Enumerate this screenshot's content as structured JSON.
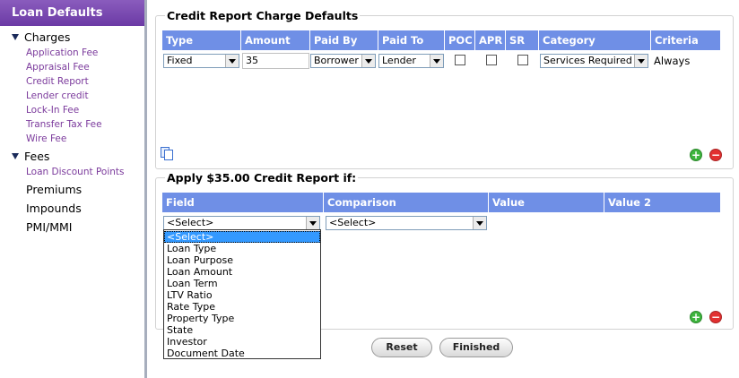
{
  "sidebar": {
    "header": "Loan Defaults",
    "groups": {
      "charges": {
        "label": "Charges",
        "items": [
          "Application Fee",
          "Appraisal Fee",
          "Credit Report",
          "Lender credit",
          "Lock-In Fee",
          "Transfer Tax Fee",
          "Wire Fee"
        ]
      },
      "fees": {
        "label": "Fees",
        "items": [
          "Loan Discount Points"
        ]
      }
    },
    "top_items": [
      "Premiums",
      "Impounds",
      "PMI/MMI"
    ]
  },
  "charges_panel": {
    "title": "Credit Report Charge Defaults",
    "columns": [
      "Type",
      "Amount",
      "Paid By",
      "Paid To",
      "POC",
      "APR",
      "SR",
      "Category",
      "Criteria"
    ],
    "row": {
      "type": "Fixed",
      "amount": "35",
      "paid_by": "Borrower",
      "paid_to": "Lender",
      "poc": false,
      "apr": false,
      "sr": false,
      "category": "Services Required",
      "criteria": "Always"
    }
  },
  "criteria_panel": {
    "title": "Apply $35.00 Credit Report if:",
    "columns": [
      "Field",
      "Comparison",
      "Value",
      "Value 2"
    ],
    "field_select": "<Select>",
    "comparison_select": "<Select>",
    "dropdown_options": [
      "<Select>",
      "Loan Type",
      "Loan Purpose",
      "Loan Amount",
      "Loan Term",
      "LTV Ratio",
      "Rate Type",
      "Property Type",
      "State",
      "Investor",
      "Document Date"
    ]
  },
  "icons": {
    "add": "+",
    "remove": "−"
  },
  "buttons": {
    "reset": "Reset",
    "finished": "Finished"
  },
  "colors": {
    "sidebar_header": "#7a4ab3",
    "table_header": "#6f8fe6",
    "link": "#7b3a9c",
    "add_icon": "#3db53d",
    "remove_icon": "#e23030",
    "dropdown_highlight": "#3399ff"
  }
}
